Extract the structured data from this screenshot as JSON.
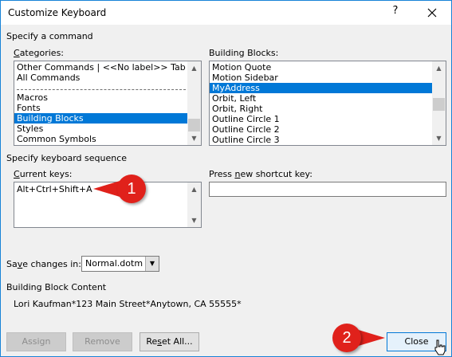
{
  "window": {
    "title": "Customize Keyboard",
    "help_glyph": "?"
  },
  "command_section": {
    "heading": "Specify a command",
    "categories": {
      "label_prefix": "C",
      "label_rest": "ategories:",
      "items": [
        {
          "label": "Other Commands | <<No label>> Tab"
        },
        {
          "label": "All Commands"
        },
        {
          "label": "---SEPARATOR---"
        },
        {
          "label": "Macros"
        },
        {
          "label": "Fonts"
        },
        {
          "label": "Building Blocks",
          "selected": true
        },
        {
          "label": "Styles"
        },
        {
          "label": "Common Symbols"
        }
      ]
    },
    "building_blocks": {
      "label": "Building Blocks:",
      "items": [
        {
          "label": "Motion Quote"
        },
        {
          "label": "Motion Sidebar"
        },
        {
          "label": "MyAddress",
          "selected": true
        },
        {
          "label": "Orbit, Left"
        },
        {
          "label": "Orbit, Right"
        },
        {
          "label": "Outline Circle 1"
        },
        {
          "label": "Outline Circle 2"
        },
        {
          "label": "Outline Circle 3"
        }
      ]
    }
  },
  "keyboard_section": {
    "heading": "Specify keyboard sequence",
    "current_keys": {
      "label_prefix": "C",
      "label_rest": "urrent keys:",
      "value": "Alt+Ctrl+Shift+A"
    },
    "new_shortcut": {
      "label_pre": "Press ",
      "label_u": "n",
      "label_rest": "ew shortcut key:",
      "value": ""
    }
  },
  "save_changes": {
    "label_prefix": "Sa",
    "label_u": "v",
    "label_rest": "e changes in:",
    "value": "Normal.dotm"
  },
  "content_section": {
    "heading": "Building Block Content",
    "content": "Lori Kaufman*123 Main Street*Anytown, CA 55555*"
  },
  "buttons": {
    "assign": "Assign",
    "remove": "Remove",
    "reset_all_pre": "Re",
    "reset_all_u": "s",
    "reset_all_rest": "et All...",
    "close": "Close"
  },
  "callouts": [
    {
      "number": "1"
    },
    {
      "number": "2"
    }
  ],
  "colors": {
    "selection": "#0078d7",
    "callout": "#e0211b",
    "accent_border": "#1883d7"
  }
}
